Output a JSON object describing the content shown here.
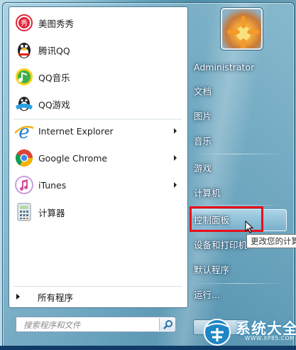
{
  "programs": [
    {
      "label": "美图秀秀",
      "icon": "meitu-icon",
      "has_arrow": false
    },
    {
      "label": "腾讯QQ",
      "icon": "qq-penguin-icon",
      "has_arrow": false
    },
    {
      "label": "QQ音乐",
      "icon": "qq-music-icon",
      "has_arrow": false
    },
    {
      "label": "QQ游戏",
      "icon": "qq-game-icon",
      "has_arrow": false
    },
    {
      "label": "Internet Explorer",
      "icon": "internet-explorer-icon",
      "has_arrow": true
    },
    {
      "label": "Google Chrome",
      "icon": "chrome-icon",
      "has_arrow": true
    },
    {
      "label": "iTunes",
      "icon": "itunes-icon",
      "has_arrow": true
    },
    {
      "label": "计算器",
      "icon": "calculator-icon",
      "has_arrow": false
    }
  ],
  "all_programs_label": "所有程序",
  "search": {
    "placeholder": "搜索程序和文件"
  },
  "right_pane": {
    "user_name": "Administrator",
    "items": [
      "文档",
      "图片",
      "音乐",
      "游戏",
      "计算机",
      "控制面板",
      "设备和打印机",
      "默认程序",
      "运行..."
    ],
    "highlighted": "控制面板"
  },
  "tooltip": "更改您的计算",
  "watermark": {
    "title": "系统大全",
    "url": "WWW.XP85.COM"
  },
  "colors": {
    "highlight_box": "#e8101a",
    "accent": "#1e86c5"
  }
}
